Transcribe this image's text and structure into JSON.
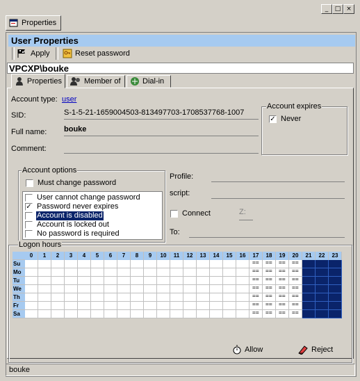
{
  "window_controls": {
    "minimize": "_",
    "maximize": "□",
    "close": "×"
  },
  "top_tab": {
    "label": "Properties",
    "icon": "properties-icon"
  },
  "header": {
    "title": "User Properties"
  },
  "toolbar": {
    "apply_label": "Apply",
    "reset_label": "Reset password"
  },
  "object_path": "VPCXP\\bouke",
  "tabs": [
    {
      "label": "Properties",
      "icon": "user-icon",
      "active": true
    },
    {
      "label": "Member of",
      "icon": "group-icon",
      "active": false
    },
    {
      "label": "Dial-in",
      "icon": "dialin-icon",
      "active": false
    }
  ],
  "account": {
    "type_label": "Account type:",
    "type_value": "user",
    "sid_label": "SID:",
    "sid_value": "S-1-5-21-1659004503-813497703-1708537768-1007",
    "fullname_label": "Full name:",
    "fullname_value": "bouke",
    "comment_label": "Comment:",
    "comment_value": ""
  },
  "expires": {
    "title": "Account expires",
    "never_label": "Never",
    "never_checked": true
  },
  "options": {
    "title": "Account options",
    "must_change": {
      "label": "Must change password",
      "checked": false
    },
    "list": [
      {
        "label": "User cannot change password",
        "checked": false,
        "selected": false
      },
      {
        "label": "Password never expires",
        "checked": true,
        "selected": false
      },
      {
        "label": "Account is disabled",
        "checked": false,
        "selected": true
      },
      {
        "label": "Account is locked out",
        "checked": false,
        "selected": false
      },
      {
        "label": "No password is required",
        "checked": false,
        "selected": false
      }
    ]
  },
  "profile": {
    "profile_label": "Profile:",
    "script_label": "script:",
    "connect_label": "Connect",
    "drive_value": "Z:",
    "to_label": "To:"
  },
  "logon_hours": {
    "title": "Logon hours",
    "hours": [
      "0",
      "1",
      "2",
      "3",
      "4",
      "5",
      "6",
      "7",
      "8",
      "9",
      "10",
      "11",
      "12",
      "13",
      "14",
      "15",
      "16",
      "17",
      "18",
      "19",
      "20",
      "21",
      "22",
      "23"
    ],
    "days": [
      "Su",
      "Mo",
      "Tu",
      "We",
      "Th",
      "Fr",
      "Sa"
    ],
    "allowed_hours_text": "17-20",
    "rejected_hours_text": "21-23",
    "allow_label": "Allow",
    "reject_label": "Reject"
  },
  "status": {
    "text": "bouke"
  }
}
